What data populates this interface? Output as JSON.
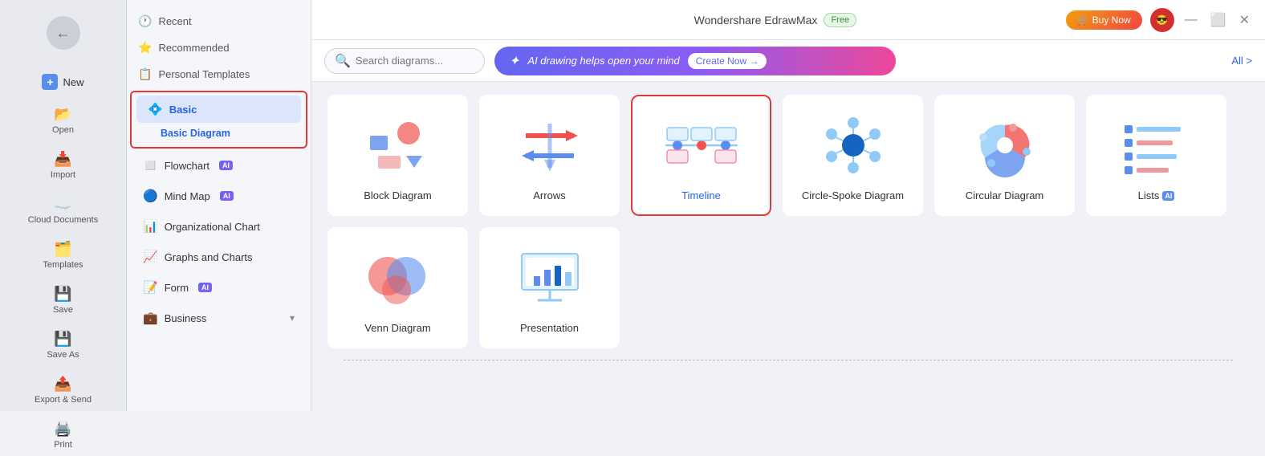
{
  "app": {
    "title": "Wondershare EdrawMax",
    "free_badge": "Free",
    "buy_now": "Buy Now"
  },
  "sidebar_narrow": {
    "items": [
      {
        "id": "new",
        "label": "New",
        "icon": "📄"
      },
      {
        "id": "open",
        "label": "Open",
        "icon": "📂"
      },
      {
        "id": "import",
        "label": "Import",
        "icon": "📥"
      },
      {
        "id": "cloud",
        "label": "Cloud Documents",
        "icon": "☁️"
      },
      {
        "id": "templates",
        "label": "Templates",
        "icon": "🗂️"
      },
      {
        "id": "save",
        "label": "Save",
        "icon": "💾"
      },
      {
        "id": "save-as",
        "label": "Save As",
        "icon": "💾"
      },
      {
        "id": "export",
        "label": "Export & Send",
        "icon": "📤"
      },
      {
        "id": "print",
        "label": "Print",
        "icon": "🖨️"
      }
    ]
  },
  "sidebar_mid": {
    "top_items": [
      {
        "id": "recent",
        "label": "Recent",
        "icon": "🕐"
      },
      {
        "id": "recommended",
        "label": "Recommended",
        "icon": "⭐"
      },
      {
        "id": "personal",
        "label": "Personal Templates",
        "icon": "📋"
      }
    ],
    "categories": [
      {
        "id": "basic",
        "label": "Basic",
        "icon": "💠",
        "active": true,
        "subcategories": [
          {
            "id": "basic-diagram",
            "label": "Basic Diagram",
            "selected": true
          }
        ]
      },
      {
        "id": "flowchart",
        "label": "Flowchart",
        "icon": "◻️",
        "has_ai": true
      },
      {
        "id": "mindmap",
        "label": "Mind Map",
        "icon": "🔵",
        "has_ai": true
      },
      {
        "id": "orgchart",
        "label": "Organizational Chart",
        "icon": "📊"
      },
      {
        "id": "graphs",
        "label": "Graphs and Charts",
        "icon": "📈"
      },
      {
        "id": "form",
        "label": "Form",
        "icon": "📝",
        "has_ai": true
      }
    ],
    "business": {
      "label": "Business",
      "collapsed": false
    }
  },
  "toolbar": {
    "search_placeholder": "Search diagrams...",
    "ai_banner_text": "AI drawing helps open your mind",
    "create_now": "Create Now →",
    "all_label": "All >"
  },
  "diagrams": {
    "row1": [
      {
        "id": "block",
        "label": "Block Diagram"
      },
      {
        "id": "arrows",
        "label": "Arrows"
      },
      {
        "id": "timeline",
        "label": "Timeline",
        "selected": true
      },
      {
        "id": "circle-spoke",
        "label": "Circle-Spoke Diagram"
      },
      {
        "id": "circular",
        "label": "Circular Diagram"
      },
      {
        "id": "lists",
        "label": "Lists",
        "has_ai": true
      }
    ],
    "row2": [
      {
        "id": "venn",
        "label": "Venn Diagram"
      },
      {
        "id": "presentation",
        "label": "Presentation"
      }
    ]
  }
}
